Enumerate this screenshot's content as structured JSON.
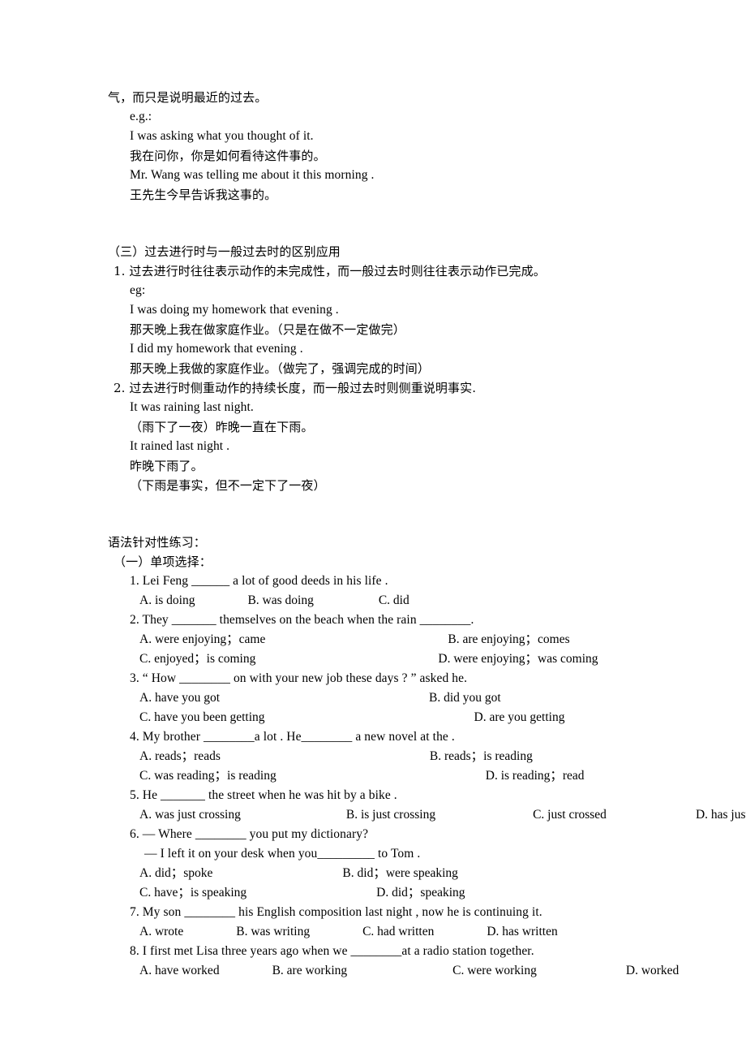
{
  "section_prev": {
    "continuation_line": "气，而只是说明最近的过去。",
    "eg_label": "e.g.:",
    "examples": [
      {
        "en": "I was asking what you thought of it.",
        "cn": "我在问你，你是如何看待这件事的。"
      },
      {
        "en": "Mr. Wang was telling me about it this morning .",
        "cn": "王先生今早告诉我这事的。"
      }
    ]
  },
  "section_three": {
    "heading": "（三）过去进行时与一般过去时的区别应用",
    "point1": {
      "number": "1.",
      "text": "过去进行时往往表示动作的未完成性，而一般过去时则往往表示动作已完成。",
      "eg_label": "eg:",
      "examples": [
        {
          "en": "I was doing my homework that evening .",
          "cn": "那天晚上我在做家庭作业。（只是在做不一定做完）"
        },
        {
          "en": "I did my homework that evening .",
          "cn": "那天晚上我做的家庭作业。（做完了，强调完成的时间）"
        }
      ]
    },
    "point2": {
      "number": "2.",
      "text": "过去进行时侧重动作的持续长度，而一般过去时则侧重说明事实.",
      "lines": [
        "It was raining last night.",
        "（雨下了一夜）昨晚一直在下雨。",
        "It rained last night .",
        "昨晚下雨了。",
        "（下雨是事实，但不一定下了一夜）"
      ]
    }
  },
  "practice": {
    "title": "语法针对性练习：",
    "part_one_title": "（一）单项选择：",
    "questions": [
      {
        "stem": "1. Lei Feng ______ a lot of good deeds in his life .",
        "option_rows": [
          [
            "A. is doing",
            "B. was doing",
            "C. did"
          ]
        ]
      },
      {
        "stem": "2. They _______ themselves on the beach when the rain ________.",
        "option_rows": [
          [
            "A. were enjoying；came",
            "B. are enjoying；comes"
          ],
          [
            "C. enjoyed；is coming",
            "D. were enjoying；was coming"
          ]
        ]
      },
      {
        "stem": "3. “ How ________ on with your new job these days ? ” asked he.",
        "option_rows": [
          [
            "A. have you got",
            "B. did you got"
          ],
          [
            "C. have you been getting",
            "D. are you getting"
          ]
        ]
      },
      {
        "stem": "4. My brother ________a lot . He________ a new novel at the .",
        "option_rows": [
          [
            "A. reads；reads",
            "B. reads；is reading"
          ],
          [
            "C. was reading；is reading",
            "D. is reading；read"
          ]
        ]
      },
      {
        "stem": "5. He _______ the street when he was hit by a bike .",
        "option_rows": [
          [
            "A. was just crossing",
            "B. is just crossing",
            "C. just crossed",
            "D. has just crossed"
          ]
        ]
      },
      {
        "stem": "6. — Where ________ you put my dictionary?",
        "stem2": "— I left it on your desk when you_________ to Tom .",
        "option_rows": [
          [
            "A. did；spoke",
            "B. did；were speaking"
          ],
          [
            "C. have；is speaking",
            "D. did；speaking"
          ]
        ]
      },
      {
        "stem": "7. My son ________ his English composition last night , now he is continuing it.",
        "option_rows": [
          [
            "A. wrote",
            "B. was writing",
            "C. had written",
            "D. has written"
          ]
        ]
      },
      {
        "stem": "8. I first met Lisa three years ago when we ________at a radio station together.",
        "option_rows": [
          [
            "A. have worked",
            "B. are working",
            "C. were working",
            "D. worked"
          ]
        ]
      }
    ]
  }
}
